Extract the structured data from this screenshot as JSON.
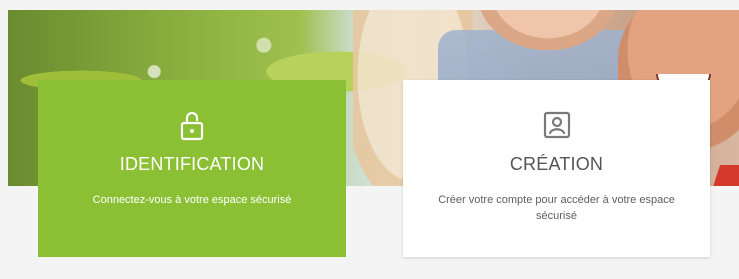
{
  "hero": {
    "image_semantic": "photo-banner-couple-smiling-foliage"
  },
  "cards": {
    "identification": {
      "icon": "lock-open-icon",
      "title": "IDENTIFICATION",
      "description": "Connectez-vous à votre espace sécurisé",
      "background_color": "#8bc034",
      "text_color": "#ffffff"
    },
    "creation": {
      "icon": "user-card-icon",
      "title": "CRÉATION",
      "description": "Créer votre compte pour accéder à votre espace sécurisé",
      "background_color": "#ffffff",
      "text_color": "#666666"
    }
  }
}
